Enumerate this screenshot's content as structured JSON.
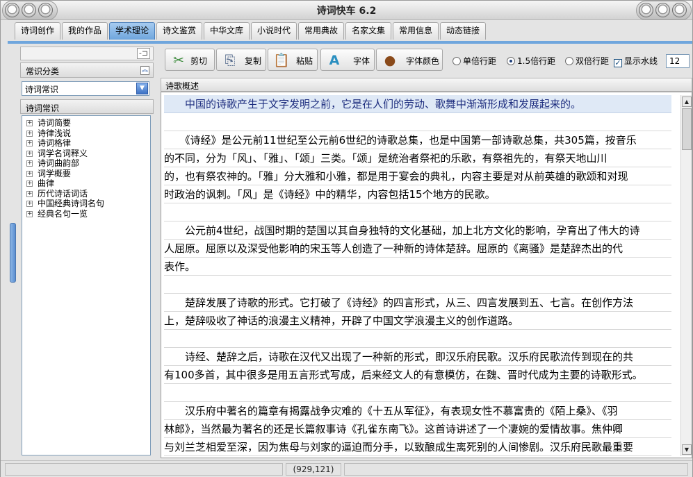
{
  "window": {
    "title": "诗词快车 6.2"
  },
  "tabs": [
    {
      "label": "诗词创作"
    },
    {
      "label": "我的作品"
    },
    {
      "label": "学术理论",
      "active": true
    },
    {
      "label": "诗文鉴赏"
    },
    {
      "label": "中华文库"
    },
    {
      "label": "小说时代"
    },
    {
      "label": "常用典故"
    },
    {
      "label": "名家文集"
    },
    {
      "label": "常用信息"
    },
    {
      "label": "动态链接"
    }
  ],
  "left_panel": {
    "category_header": "常识分类",
    "category_select": "诗词常识",
    "tree_header": "诗词常识",
    "tree_items": [
      "诗词简要",
      "诗律浅说",
      "诗词格律",
      "词学名词释义",
      "诗词曲韵部",
      "词学概要",
      "曲律",
      "历代诗话词话",
      "中国经典诗词名句",
      "经典名句一览"
    ]
  },
  "toolbar": {
    "cut": "剪切",
    "copy": "复制",
    "paste": "粘贴",
    "font": "字体",
    "font_color": "字体颜色",
    "spacing_single": "单倍行距",
    "spacing_one_half": "1.5倍行距",
    "spacing_double": "双倍行距",
    "show_watermark": "显示水线",
    "font_size": "12",
    "selected_spacing": "1.5倍行距"
  },
  "article": {
    "tab_label": "诗歌概述",
    "lines": [
      "　　中国的诗歌产生于文字发明之前，它是在人们的劳动、歌舞中渐渐形成和发展起来的。",
      "",
      "　　《诗经》是公元前11世纪至公元前6世纪的诗歌总集，也是中国第一部诗歌总集，共305篇，按音乐",
      "的不同，分为「风」、「雅」、「颂」三类。「颂」是统治者祭祀的乐歌，有祭祖先的，有祭天地山川",
      "的，也有祭农神的。「雅」分大雅和小雅，都是用于宴会的典礼，内容主要是对从前英雄的歌颂和对现",
      "时政治的讽刺。「风」是《诗经》中的精华，内容包括15个地方的民歌。",
      "",
      "　　公元前4世纪，战国时期的楚国以其自身独特的文化基础，加上北方文化的影响，孕育出了伟大的诗",
      "人屈原。屈原以及深受他影响的宋玉等人创造了一种新的诗体楚辞。屈原的《离骚》是楚辞杰出的代",
      "表作。",
      "",
      "　　楚辞发展了诗歌的形式。它打破了《诗经》的四言形式，从三、四言发展到五、七言。在创作方法",
      "上，楚辞吸收了神话的浪漫主义精神，开辟了中国文学浪漫主义的创作道路。",
      "",
      "　　诗经、楚辞之后，诗歌在汉代又出现了一种新的形式，即汉乐府民歌。汉乐府民歌流传到现在的共",
      "有100多首，其中很多是用五言形式写成，后来经文人的有意模仿，在魏、晋时代成为主要的诗歌形式。",
      "",
      "　　汉乐府中著名的篇章有揭露战争灾难的《十五从军征》，有表现女性不慕富贵的《陌上桑》、《羽",
      "林郎》，当然最为著名的还是长篇叙事诗《孔雀东南飞》。这首诗讲述了一个凄婉的爱情故事。焦仲卿",
      "与刘兰芝相爱至深，因为焦母与刘家的逼迫而分手，以致酿成生离死别的人间惨剧。汉乐府民歌最重要"
    ]
  },
  "status": {
    "coords": "(929,121)"
  },
  "colors": {
    "accent": "#6fa6dd",
    "first_line_text": "#1c2c7e",
    "first_line_bg": "#dfe9f6"
  }
}
